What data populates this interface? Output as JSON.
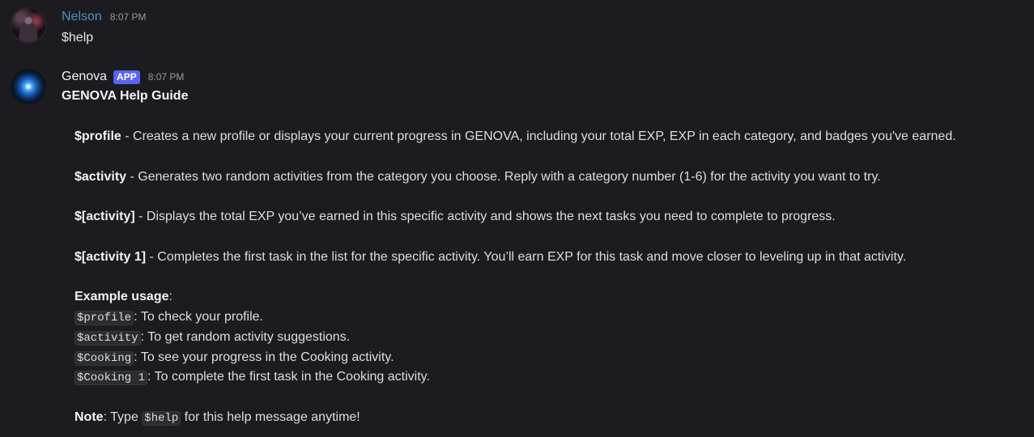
{
  "messages": {
    "nelson": {
      "author": "Nelson",
      "time": "8:07 PM",
      "text": "$help"
    },
    "genova": {
      "author": "Genova",
      "badge": "APP",
      "time": "8:07 PM",
      "title": "GENOVA Help Guide",
      "commands": [
        {
          "cmd": "$profile",
          "desc": " - Creates a new profile or displays your current progress in GENOVA, including your total EXP, EXP in each category, and badges you've earned."
        },
        {
          "cmd": "$activity",
          "desc": " - Generates two random activities from the category you choose. Reply with a category number (1-6) for the activity you want to try."
        },
        {
          "cmd": "$[activity]",
          "desc": " - Displays the total EXP you’ve earned in this specific activity and shows the next tasks you need to complete to progress."
        },
        {
          "cmd": "$[activity 1]",
          "desc": " - Completes the first task in the list for the specific activity. You’ll earn EXP for this task and move closer to leveling up in that activity."
        }
      ],
      "example_heading": "Example usage",
      "examples": [
        {
          "code": "$profile",
          "desc": ": To check your profile."
        },
        {
          "code": "$activity",
          "desc": ": To get random activity suggestions."
        },
        {
          "code": "$Cooking",
          "desc": ": To see your progress in the Cooking activity."
        },
        {
          "code": "$Cooking 1",
          "desc": ": To complete the first task in the Cooking activity."
        }
      ],
      "note_label": "Note",
      "note_pre": ": Type ",
      "note_code": "$help",
      "note_post": " for this help message anytime!"
    }
  },
  "colors": {
    "background": "#1c1c20",
    "nelson_name": "#4f8fc0",
    "app_badge": "#5865f2"
  }
}
